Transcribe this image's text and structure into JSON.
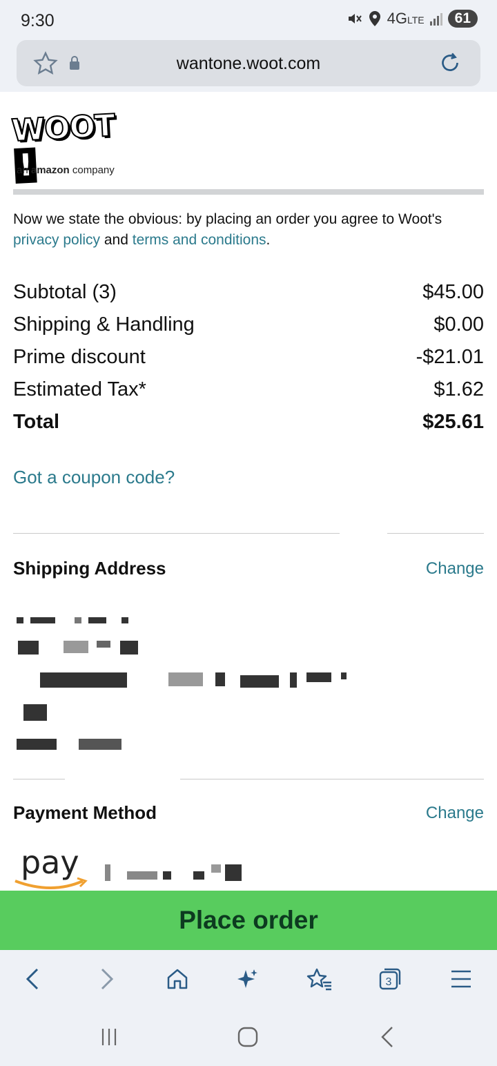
{
  "status": {
    "time": "9:30",
    "network": "4G",
    "network_sub": "LTE",
    "battery": "61"
  },
  "browser": {
    "url": "wantone.woot.com"
  },
  "logo": {
    "word": "WOOT",
    "bang": "!",
    "sub_prefix": "an ",
    "sub_brand": "amazon",
    "sub_suffix": " company"
  },
  "notice": {
    "text_1": "Now we state the obvious: by placing an order you agree to Woot's ",
    "privacy_link": "privacy policy",
    "text_2": " and ",
    "terms_link": "terms and conditions",
    "text_3": "."
  },
  "summary": [
    {
      "label": "Subtotal (3)",
      "value": "$45.00"
    },
    {
      "label": "Shipping & Handling",
      "value": "$0.00"
    },
    {
      "label": "Prime discount",
      "value": "-$21.01"
    },
    {
      "label": "Estimated Tax*",
      "value": "$1.62"
    },
    {
      "label": "Total",
      "value": "$25.61"
    }
  ],
  "coupon": {
    "label": "Got a coupon code?"
  },
  "shipping": {
    "title": "Shipping Address",
    "change": "Change"
  },
  "payment": {
    "title": "Payment Method",
    "change": "Change",
    "logo_text": "pay"
  },
  "actions": {
    "place_order": "Place order"
  },
  "nav": {
    "tabs_count": "3",
    "icons": [
      "back-icon",
      "forward-icon",
      "home-icon",
      "sparkle-icon",
      "bookmarks-icon",
      "tabs-icon",
      "menu-icon"
    ]
  },
  "colors": {
    "accent_link": "#2b7a8c",
    "place_order_bg": "#58cc5e",
    "place_order_text": "#0d3b20"
  }
}
